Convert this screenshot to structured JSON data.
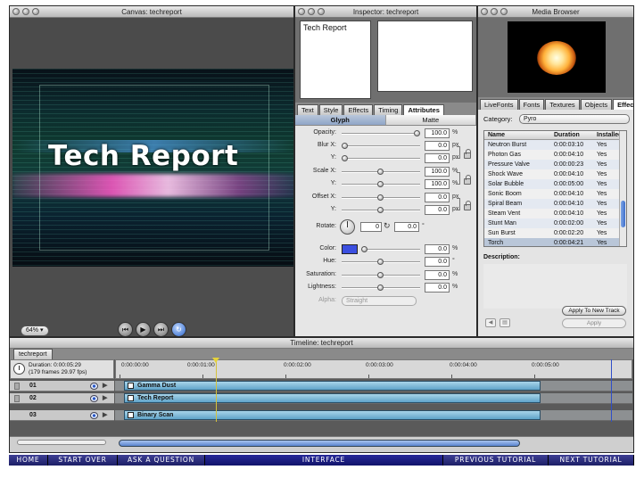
{
  "canvas": {
    "title": "Canvas: techreport",
    "stage_title": "Tech Report",
    "zoom": "64%"
  },
  "inspector": {
    "title": "Inspector: techreport",
    "preview_text": "Tech Report",
    "tabs": [
      "Text",
      "Style",
      "Effects",
      "Timing",
      "Attributes"
    ],
    "active_tab": "Attributes",
    "subtabs": [
      "Glyph",
      "Matte"
    ],
    "params": {
      "opacity": {
        "label": "Opacity:",
        "value": "100.0",
        "unit": "%",
        "level": 0.97
      },
      "blur_x": {
        "label": "Blur X:",
        "value": "0.0",
        "unit": "px",
        "level": 0.02
      },
      "blur_y": {
        "label": "Y:",
        "value": "0.0",
        "unit": "px",
        "level": 0.02
      },
      "scale_x": {
        "label": "Scale X:",
        "value": "100.0",
        "unit": "%",
        "level": 0.5
      },
      "scale_y": {
        "label": "Y:",
        "value": "100.0",
        "unit": "%",
        "level": 0.5
      },
      "offset_x": {
        "label": "Offset X:",
        "value": "0.0",
        "unit": "px",
        "level": 0.5
      },
      "offset_y": {
        "label": "Y:",
        "value": "0.0",
        "unit": "px",
        "level": 0.5
      },
      "rotate": {
        "label": "Rotate:",
        "value_a": "0",
        "value_b": "0.0",
        "unit": "°"
      },
      "color": {
        "label": "Color:",
        "value": "0.0",
        "unit": "%",
        "swatch": "#3b4fe0",
        "level": 0.0
      },
      "hue": {
        "label": "Hue:",
        "value": "0.0",
        "unit": "°",
        "level": 0.5
      },
      "saturation": {
        "label": "Saturation:",
        "value": "0.0",
        "unit": "%",
        "level": 0.5
      },
      "lightness": {
        "label": "Lightness:",
        "value": "0.0",
        "unit": "%",
        "level": 0.5
      },
      "alpha": {
        "label": "Alpha:",
        "value": "Straight"
      }
    }
  },
  "media": {
    "title": "Media Browser",
    "tabs": [
      "LiveFonts",
      "Fonts",
      "Textures",
      "Objects",
      "Effects"
    ],
    "active_tab": "Effects",
    "category_label": "Category:",
    "category_value": "Pyro",
    "columns": [
      "Name",
      "Duration",
      "Installed"
    ],
    "rows": [
      [
        "Neutron Burst",
        "0:00:03:10",
        "Yes"
      ],
      [
        "Photon Gas",
        "0:00:04:10",
        "Yes"
      ],
      [
        "Pressure Valve",
        "0:00:00:23",
        "Yes"
      ],
      [
        "Shock Wave",
        "0:00:04:10",
        "Yes"
      ],
      [
        "Solar Bubble",
        "0:00:05:00",
        "Yes"
      ],
      [
        "Sonic Boom",
        "0:00:04:10",
        "Yes"
      ],
      [
        "Spiral Beam",
        "0:00:04:10",
        "Yes"
      ],
      [
        "Steam Vent",
        "0:00:04:10",
        "Yes"
      ],
      [
        "Stunt Man",
        "0:00:02:00",
        "Yes"
      ],
      [
        "Sun Burst",
        "0:00:02:20",
        "Yes"
      ],
      [
        "Torch",
        "0:00:04:21",
        "Yes"
      ]
    ],
    "selected_row": 10,
    "description_label": "Description:",
    "apply_new_track": "Apply To New Track",
    "apply": "Apply"
  },
  "timeline": {
    "title": "Timeline: techreport",
    "tab": "techreport",
    "duration": "Duration: 0:00:05:29",
    "frames": "(179 frames 29.97 fps)",
    "ruler": [
      "0:00:00:00",
      "0:00:01:00",
      "0:00:02:00",
      "0:00:03:00",
      "0:00:04:00",
      "0:00:05:00"
    ],
    "tracks": [
      {
        "num": "01",
        "clip": "Gamma Dust"
      },
      {
        "num": "02",
        "clip": "Tech Report"
      },
      {
        "num": "03",
        "clip": "Binary Scan"
      }
    ]
  },
  "nav": {
    "home": "HOME",
    "start_over": "START OVER",
    "ask": "ASK A QUESTION",
    "interface": "INTERFACE",
    "prev": "PREVIOUS TUTORIAL",
    "next": "NEXT TUTORIAL"
  }
}
